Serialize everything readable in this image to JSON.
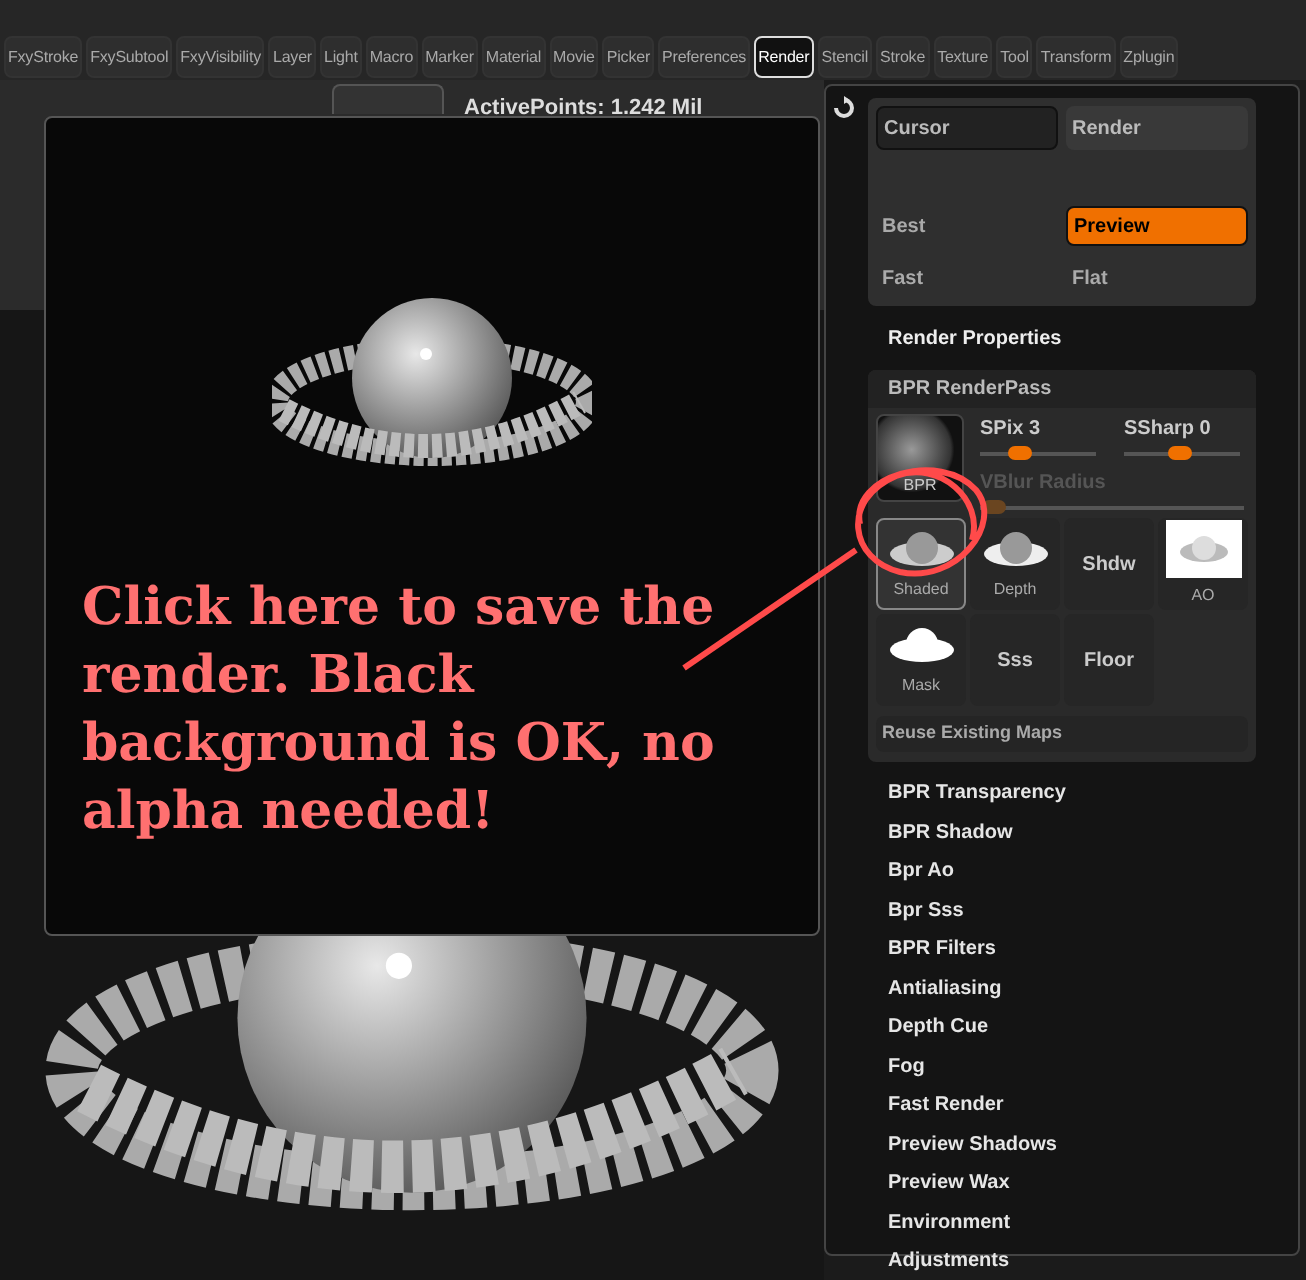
{
  "tabs": [
    {
      "label": "FxyStroke",
      "selected": false
    },
    {
      "label": "FxySubtool",
      "selected": false
    },
    {
      "label": "FxyVisibility",
      "selected": false
    },
    {
      "label": "Layer",
      "selected": false
    },
    {
      "label": "Light",
      "selected": false
    },
    {
      "label": "Macro",
      "selected": false
    },
    {
      "label": "Marker",
      "selected": false
    },
    {
      "label": "Material",
      "selected": false
    },
    {
      "label": "Movie",
      "selected": false
    },
    {
      "label": "Picker",
      "selected": false
    },
    {
      "label": "Preferences",
      "selected": false
    },
    {
      "label": "Render",
      "selected": true
    },
    {
      "label": "Stencil",
      "selected": false
    },
    {
      "label": "Stroke",
      "selected": false
    },
    {
      "label": "Texture",
      "selected": false
    },
    {
      "label": "Tool",
      "selected": false
    },
    {
      "label": "Transform",
      "selected": false
    },
    {
      "label": "Zplugin",
      "selected": false
    }
  ],
  "status": {
    "active_points": "ActivePoints: 1.242 Mil"
  },
  "render_preview": {
    "annotation": "Click here to save the render. Black background is OK, no alpha needed!"
  },
  "render_panel": {
    "buttons": [
      {
        "label": "Cursor",
        "selected": true
      },
      {
        "label": "Render",
        "selected": false
      }
    ],
    "modes": [
      {
        "label": "Best",
        "selected": false
      },
      {
        "label": "Preview",
        "selected": true
      },
      {
        "label": "Fast",
        "selected": false
      },
      {
        "label": "Flat",
        "selected": false
      }
    ],
    "section_title": "Render Properties",
    "renderpass": {
      "title": "BPR RenderPass",
      "bpr_button": "BPR",
      "sliders": [
        {
          "label": "SPix 3",
          "level": 0.35,
          "disabled": false
        },
        {
          "label": "SSharp 0",
          "level": 0.48,
          "disabled": false
        }
      ],
      "vblur": {
        "label": "VBlur Radius",
        "level": 0.05,
        "disabled": true
      },
      "passes": [
        {
          "label": "Shaded",
          "kind": "thumb",
          "selected": true
        },
        {
          "label": "Depth",
          "kind": "thumb",
          "selected": false
        },
        {
          "label": "Shdw",
          "kind": "text",
          "selected": false
        },
        {
          "label": "AO",
          "kind": "thumb",
          "selected": false
        },
        {
          "label": "Mask",
          "kind": "thumb",
          "selected": false
        },
        {
          "label": "Sss",
          "kind": "text",
          "selected": false
        },
        {
          "label": "Floor",
          "kind": "text",
          "selected": false
        }
      ],
      "reuse": "Reuse Existing Maps"
    },
    "items": [
      "BPR Transparency",
      "BPR Shadow",
      "Bpr Ao",
      "Bpr Sss",
      "BPR Filters",
      "Antialiasing",
      "Depth Cue",
      "Fog",
      "Fast Render",
      "Preview Shadows",
      "Preview Wax",
      "Environment",
      "Adjustments"
    ]
  }
}
